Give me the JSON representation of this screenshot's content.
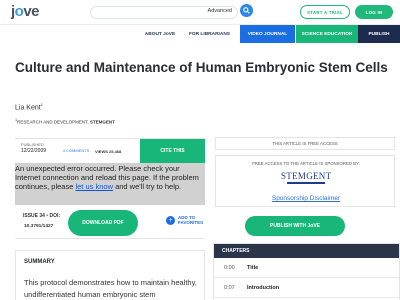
{
  "header": {
    "logo_prefix": "j",
    "logo_o": "o",
    "logo_suffix": "ve",
    "search_advanced": "Advanced",
    "start_trial": "START A TRIAL",
    "login": "LOG IN"
  },
  "nav": {
    "about": "ABOUT JoVE",
    "librarians": "FOR LIBRARIANS",
    "video_journal": "VIDEO JOURNAL",
    "science_education": "SCIENCE EDUCATION",
    "publish": "PUBLISH"
  },
  "article": {
    "title": "Culture and Maintenance of Human Embryonic Stem Cells",
    "author": "Lia Kent",
    "author_sup": "1",
    "affiliation_sup": "1",
    "affiliation_prefix": "Research and Development, ",
    "affiliation_org": "Stemgent"
  },
  "stats": {
    "published_label": "PUBLISHED",
    "published_date": "12/22/2009",
    "comments": "4 COMMENTS",
    "views_label": "VIEWS",
    "views_count": "25,468",
    "cite_label": "CITE THIS"
  },
  "error": {
    "text_before": "An unexpected error occurred. Please check your Internet connection and reload this page. If the problem continues, please ",
    "link": "let us know",
    "text_after": " and we'll try to help."
  },
  "doi": {
    "issue_label": "ISSUE 34",
    "doi_label": "DOI:",
    "doi_value": "10.3791/1427",
    "download_label": "DOWNLOAD PDF",
    "favorites_line1": "ADD TO",
    "favorites_line2": "FAVORITES"
  },
  "summary": {
    "heading": "SUMMARY",
    "text": "This protocol demonstrates how to maintain healthy, undifferentiated human embryonic stem"
  },
  "sidebar": {
    "free_access": "THIS ARTICLE IS FREE ACCESS",
    "sponsor_label": "FREE ACCESS TO THE ARTICLE IS SPONSORED BY:",
    "sponsor_name": "STEMGENT",
    "sponsor_disclaimer": "Sponsorship Disclaimer",
    "publish_label": "PUBLISH WITH JoVE"
  },
  "chapters": {
    "heading": "CHAPTERS",
    "items": [
      {
        "time": "0:00",
        "title": "Title"
      },
      {
        "time": "0:07",
        "title": "Introduction"
      }
    ]
  },
  "colors": {
    "green": "#19b67a",
    "blue": "#1b6ee0",
    "navy": "#1d2b4e"
  }
}
